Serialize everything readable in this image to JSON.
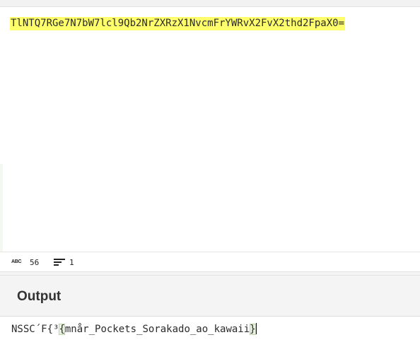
{
  "input": {
    "text": "TlNTQ7RGe7N7bW7lcl9Qb2NrZXRzX1NvcmFrYWRvX2FvX2thd2FpaX0="
  },
  "status": {
    "char_count_icon": "abc-icon",
    "char_count_icon_text": "ABC",
    "char_count": "56",
    "line_count_icon": "lines-icon",
    "line_count": "1"
  },
  "output": {
    "title": "Output",
    "text_prefix": "NSSC´F{³",
    "open_brace": "{",
    "text_middle": "mnår_Pockets_Sorakado_ao_kawaii",
    "close_brace": "}"
  },
  "colors": {
    "input_highlight": "#ffff6b",
    "bracket_highlight": "#e9f1df"
  }
}
